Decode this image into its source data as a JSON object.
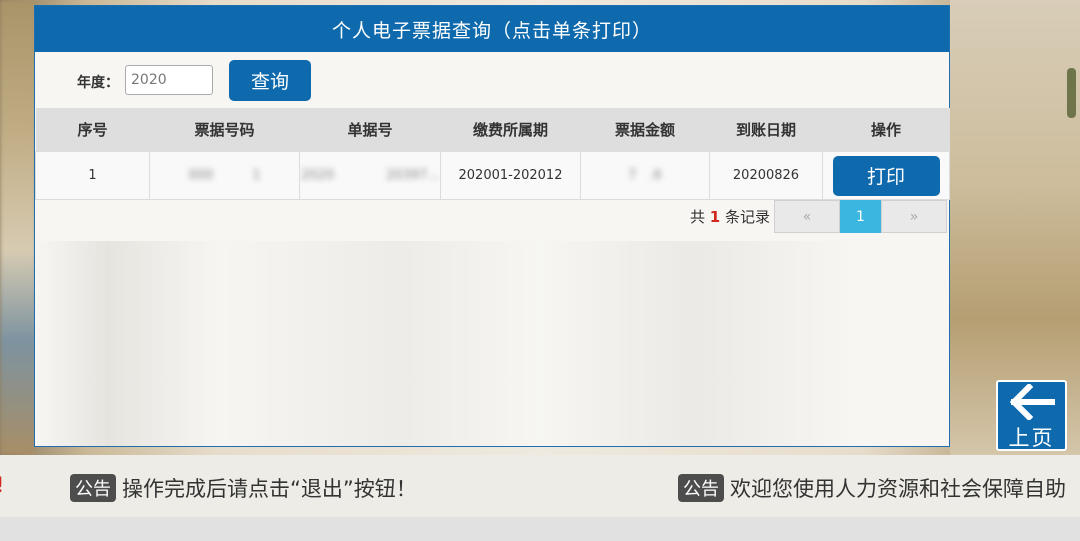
{
  "header": {
    "title": "个人电子票据查询（点击单条打印）"
  },
  "search": {
    "year_label": "年度：",
    "year_value": "2020",
    "query_button": "查询"
  },
  "table": {
    "columns": [
      "序号",
      "票据号码",
      "单据号",
      "缴费所属期",
      "票据金额",
      "到账日期",
      "操作"
    ],
    "rows": [
      {
        "index": "1",
        "bill_no": "000   1",
        "doc_no": "2020    20397...",
        "period": "202001-202012",
        "amount": "7 .6",
        "arrival_date": "20200826",
        "action": "打印"
      }
    ]
  },
  "pager": {
    "prefix": "共",
    "count": "1",
    "suffix": "条记录",
    "prev": "«",
    "current_page": "1",
    "next": "»"
  },
  "back_button": {
    "label": "上页",
    "icon": "arrow-left-icon"
  },
  "ticker": {
    "fragment": "!",
    "items": [
      {
        "tag": "公告",
        "text": "操作完成后请点击“退出”按钮！"
      },
      {
        "tag": "公告",
        "text": "欢迎您使用人力资源和社会保障自助"
      }
    ]
  },
  "colors": {
    "primary": "#0e6aad",
    "active_page": "#3bb6e0",
    "alert": "#d0261d"
  }
}
